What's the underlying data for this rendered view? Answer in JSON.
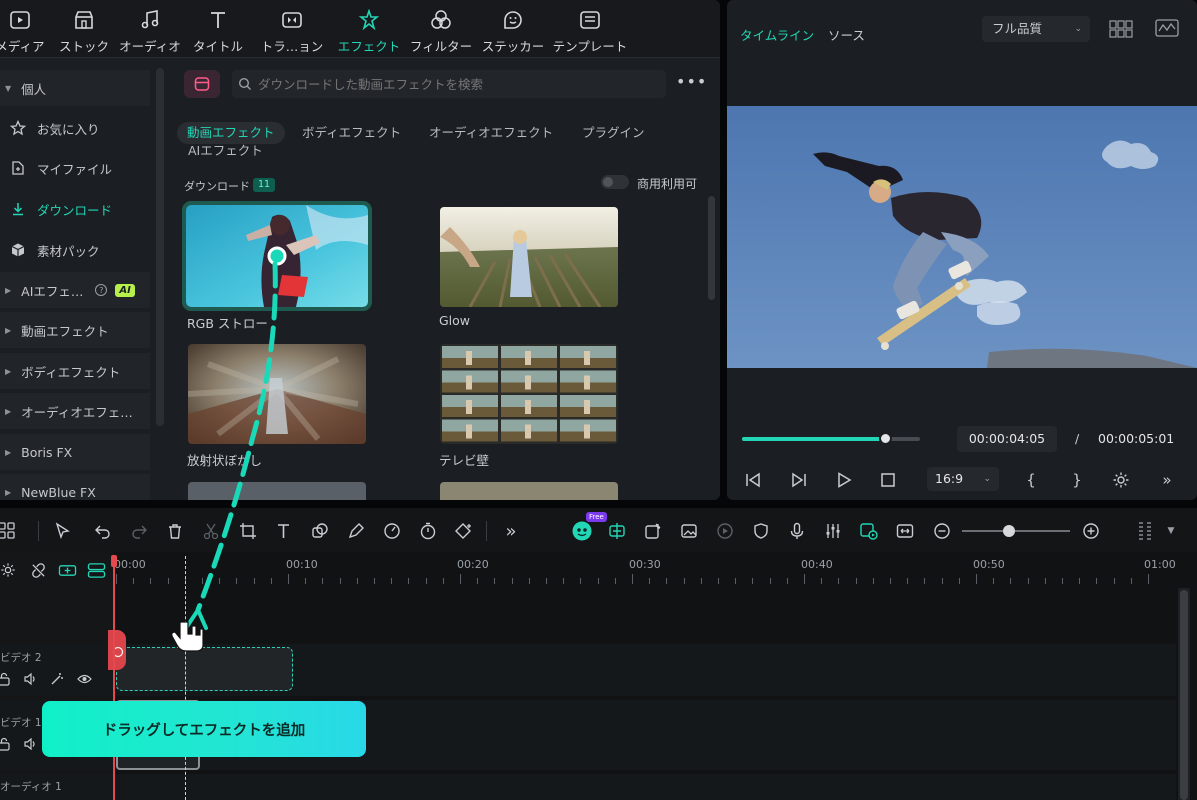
{
  "top_tabs": [
    {
      "label": "メディア",
      "icon": "media-icon"
    },
    {
      "label": "ストック",
      "icon": "stock-icon"
    },
    {
      "label": "オーディオ",
      "icon": "music-note-icon"
    },
    {
      "label": "タイトル",
      "icon": "title-t-icon"
    },
    {
      "label": "トラ…ョン",
      "icon": "transition-icon"
    },
    {
      "label": "エフェクト",
      "icon": "effects-star-icon",
      "active": true
    },
    {
      "label": "フィルター",
      "icon": "filter-icon"
    },
    {
      "label": "ステッカー",
      "icon": "sticker-icon"
    },
    {
      "label": "テンプレート",
      "icon": "template-icon"
    }
  ],
  "sidebar": {
    "items": [
      {
        "label": "個人",
        "type": "header"
      },
      {
        "label": "お気に入り",
        "icon": "star-icon"
      },
      {
        "label": "マイファイル",
        "icon": "my-files-icon"
      },
      {
        "label": "ダウンロード",
        "icon": "download-icon",
        "active": true
      },
      {
        "label": "素材パック",
        "icon": "package-icon"
      },
      {
        "label": "AIエフェ…",
        "type": "group",
        "badge": "AI"
      },
      {
        "label": "動画エフェクト",
        "type": "group"
      },
      {
        "label": "ボディエフェクト",
        "type": "group"
      },
      {
        "label": "オーディオエフェ…",
        "type": "group"
      },
      {
        "label": "Boris FX",
        "type": "group"
      },
      {
        "label": "NewBlue FX",
        "type": "group"
      }
    ]
  },
  "search": {
    "placeholder": "ダウンロードした動画エフェクトを検索"
  },
  "category_tabs": [
    "動画エフェクト",
    "ボディエフェクト",
    "オーディオエフェクト",
    "プラグイン",
    "AIエフェクト"
  ],
  "downloads": {
    "label": "ダウンロード",
    "count": "11",
    "toggle_label": "商用利用可"
  },
  "effects": [
    {
      "name": "RGB ストロー",
      "selected": true
    },
    {
      "name": "Glow"
    },
    {
      "name": "放射状ぼかし"
    },
    {
      "name": "テレビ壁"
    }
  ],
  "preview": {
    "tabs": [
      "タイムライン",
      "ソース"
    ],
    "quality": "フル品質",
    "current_time": "00:00:04:05",
    "separator": "/",
    "total_time": "00:00:05:01",
    "progress": 0.8,
    "aspect_ratio": "16:9"
  },
  "timeline": {
    "free_badge": "Free",
    "ruler_labels": [
      "00:00",
      "00:10",
      "00:20",
      "00:30",
      "00:40",
      "00:50",
      "01:00"
    ],
    "tracks": [
      "ビデオ 2",
      "ビデオ 1",
      "オーディオ 1"
    ]
  },
  "cta": {
    "label": "ドラッグしてエフェクトを追加"
  },
  "colors": {
    "accent": "#23d6b5",
    "playhead": "#e5484d",
    "cta_start": "#10f0c8",
    "cta_end": "#29d8e8"
  }
}
